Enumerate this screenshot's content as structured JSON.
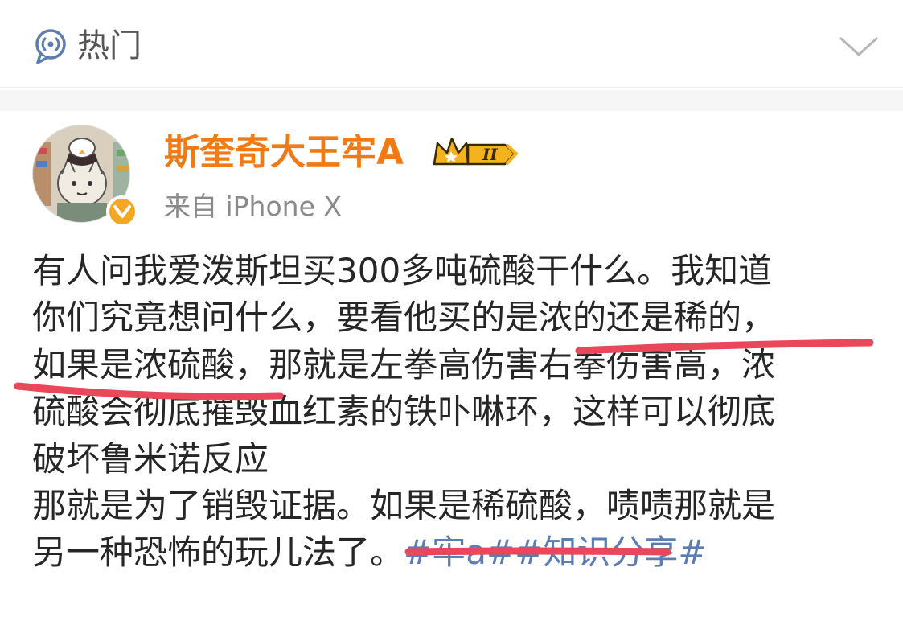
{
  "topbar": {
    "section_label": "热门",
    "section_icon": "hot-signal-icon",
    "collapse_icon": "chevron-down-icon"
  },
  "post": {
    "username": "斯奎奇大王牢A",
    "vip_level": "II",
    "source": "来自 iPhone X",
    "body_lines": [
      "有人问我爱泼斯坦买300多吨硫酸干什么。我知道",
      "你们究竟想问什么，要看他买的是浓的还是稀的，",
      "如果是浓硫酸，那就是左拳高伤害右拳伤害高，浓",
      "硫酸会彻底摧毁血红素的铁卟啉环，这样可以彻底",
      "破坏鲁米诺反应",
      "那就是为了销毁证据。如果是稀硫酸，啧啧那就是"
    ],
    "last_line_text": "另一种恐怖的玩儿法了。",
    "topics": [
      "#牢a#",
      "#知识分享#"
    ]
  },
  "colors": {
    "username": "#f07b16",
    "topic": "#5b7db1",
    "underline": "#e8485a",
    "badge": "#f5a623"
  }
}
